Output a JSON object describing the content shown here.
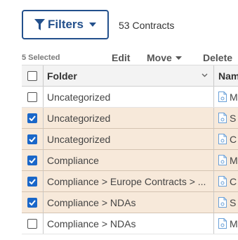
{
  "filters_button": {
    "label": "Filters",
    "icon": "funnel-icon",
    "dropdown_icon": "caret-down-icon"
  },
  "contracts_count": "53 Contracts",
  "toolbar": {
    "selected_count": "5 Selected",
    "edit_label": "Edit",
    "move_label": "Move",
    "delete_label": "Delete"
  },
  "table": {
    "columns": {
      "folder": "Folder",
      "name": "Nam"
    },
    "rows": [
      {
        "folder": "Uncategorized",
        "name": "M",
        "checked": false
      },
      {
        "folder": "Uncategorized",
        "name": "S",
        "checked": true
      },
      {
        "folder": "Uncategorized",
        "name": "C",
        "checked": true
      },
      {
        "folder": "Compliance",
        "name": "M",
        "checked": true
      },
      {
        "folder": "Compliance > Europe Contracts > ...",
        "name": "C",
        "checked": true
      },
      {
        "folder": "Compliance > NDAs",
        "name": "S",
        "checked": true
      },
      {
        "folder": "Compliance > NDAs",
        "name": "M",
        "checked": false
      }
    ]
  },
  "colors": {
    "accent": "#23508c",
    "checkbox_checked": "#1a67c9",
    "selected_row": "#f7e9da",
    "doc_icon": "#6aa0d8"
  }
}
